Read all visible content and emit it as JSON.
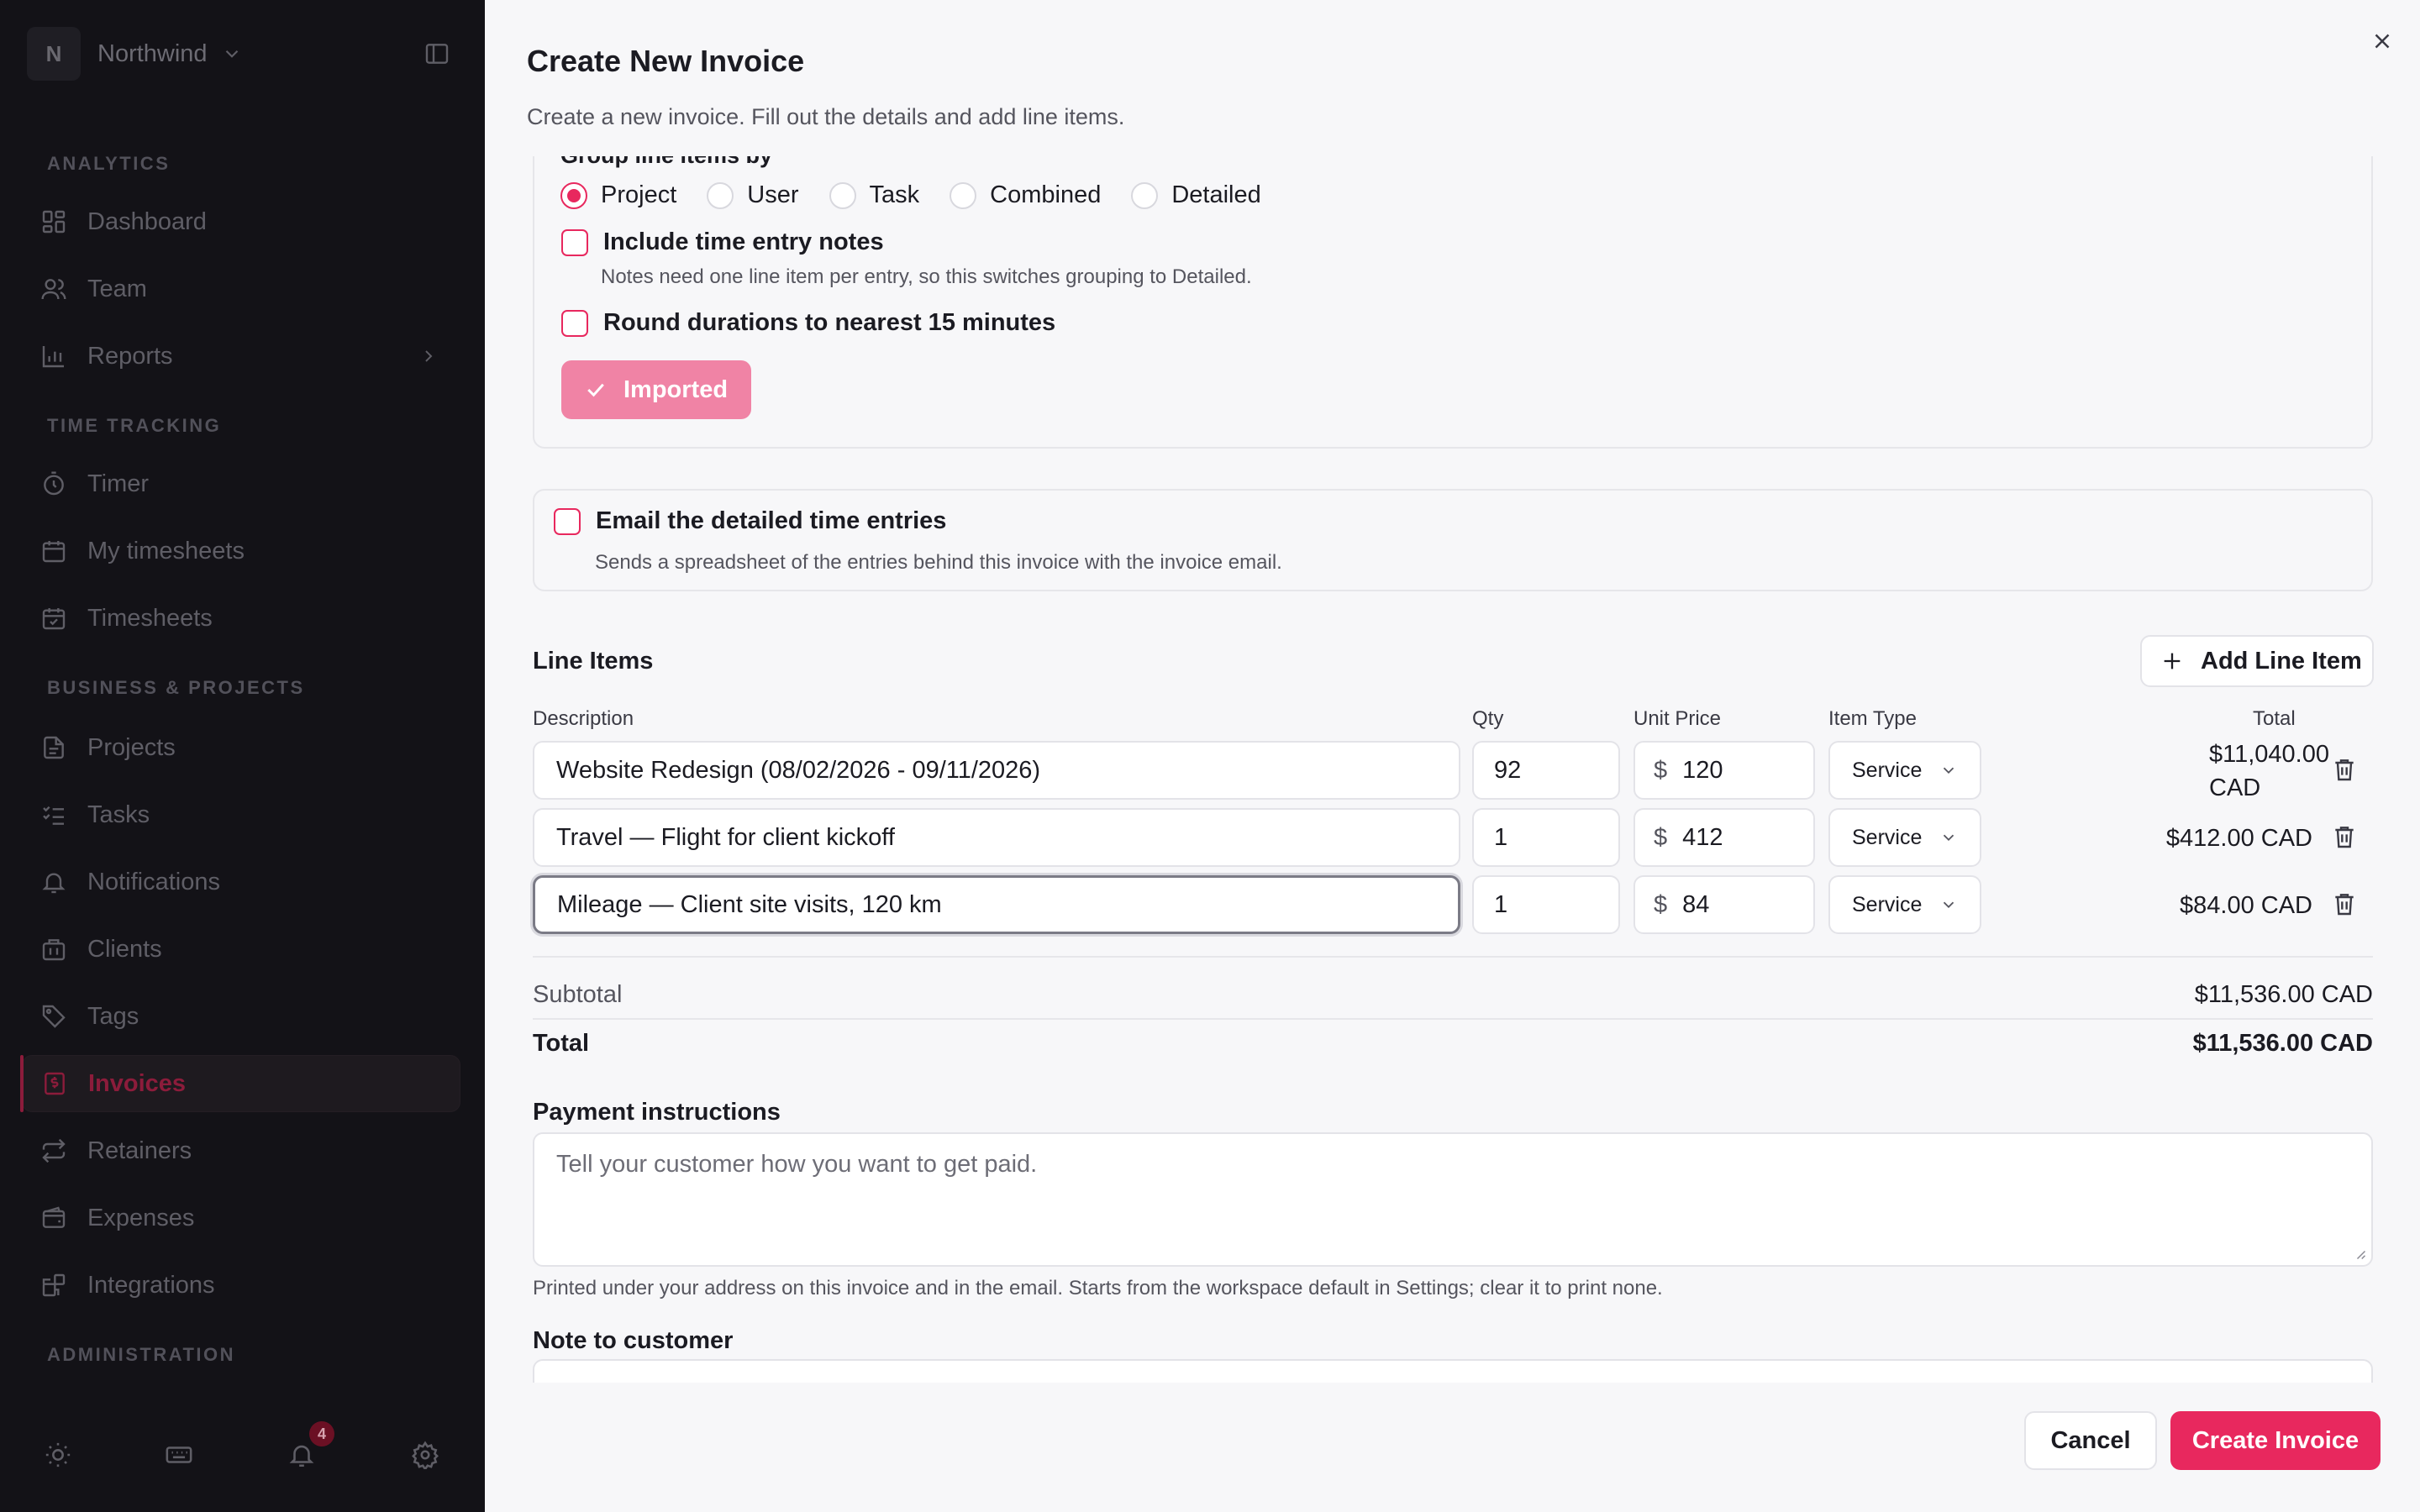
{
  "sidebar": {
    "workspace": {
      "initial": "N",
      "name": "Northwind"
    },
    "sections": {
      "analytics": "ANALYTICS",
      "time_tracking": "TIME TRACKING",
      "business": "BUSINESS & PROJECTS",
      "administration": "ADMINISTRATION"
    },
    "items": {
      "dashboard": "Dashboard",
      "team": "Team",
      "reports": "Reports",
      "timer": "Timer",
      "my_timesheets": "My timesheets",
      "timesheets": "Timesheets",
      "projects": "Projects",
      "tasks": "Tasks",
      "notifications": "Notifications",
      "clients": "Clients",
      "tags": "Tags",
      "invoices": "Invoices",
      "retainers": "Retainers",
      "expenses": "Expenses",
      "integrations": "Integrations"
    },
    "notification_count": "4",
    "accent_color": "#8c1c3b"
  },
  "dialog": {
    "title": "Create New Invoice",
    "subtitle": "Create a new invoice. Fill out the details and add line items.",
    "group_by": {
      "label": "Group line items by",
      "options": [
        "Project",
        "User",
        "Task",
        "Combined",
        "Detailed"
      ],
      "selected": "Project"
    },
    "include_notes": {
      "label": "Include time entry notes",
      "hint": "Notes need one line item per entry, so this switches grouping to Detailed.",
      "checked": false
    },
    "round_durations": {
      "label": "Round durations to nearest 15 minutes",
      "checked": false
    },
    "imported_button": "Imported",
    "email_entries": {
      "label": "Email the detailed time entries",
      "hint": "Sends a spreadsheet of the entries behind this invoice with the invoice email.",
      "checked": false
    },
    "line_items": {
      "title": "Line Items",
      "add_button": "Add Line Item",
      "headers": {
        "description": "Description",
        "qty": "Qty",
        "unit_price": "Unit Price",
        "item_type": "Item Type",
        "total": "Total"
      },
      "currency_symbol": "$",
      "rows": [
        {
          "description": "Website Redesign (08/02/2026 - 09/11/2026)",
          "qty": "92",
          "unit_price": "120",
          "item_type": "Service",
          "total_line1": "$11,040.00",
          "total_line2": "CAD"
        },
        {
          "description": "Travel — Flight for client kickoff",
          "qty": "1",
          "unit_price": "412",
          "item_type": "Service",
          "total_line1": "$412.00 CAD",
          "total_line2": ""
        },
        {
          "description": "Mileage — Client site visits, 120 km",
          "qty": "1",
          "unit_price": "84",
          "item_type": "Service",
          "total_line1": "$84.00 CAD",
          "total_line2": ""
        }
      ]
    },
    "subtotal": {
      "label": "Subtotal",
      "value": "$11,536.00 CAD"
    },
    "total": {
      "label": "Total",
      "value": "$11,536.00 CAD"
    },
    "payment_instructions": {
      "label": "Payment instructions",
      "placeholder": "Tell your customer how you want to get paid.",
      "hint": "Printed under your address on this invoice and in the email. Starts from the workspace default in Settings; clear it to print none."
    },
    "note_to_customer": {
      "label": "Note to customer"
    },
    "cancel_button": "Cancel",
    "create_button": "Create Invoice",
    "accent_color": "#e8285e"
  }
}
